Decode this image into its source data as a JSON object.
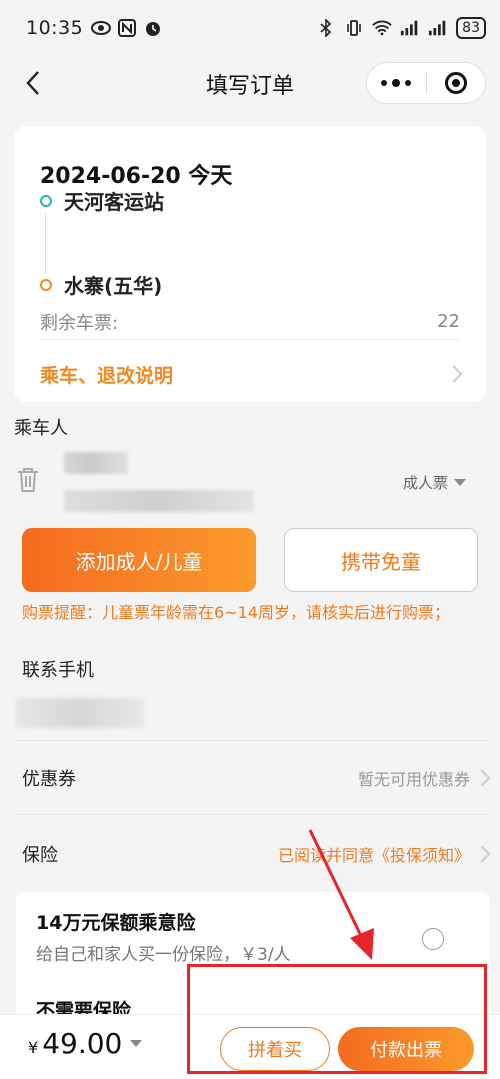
{
  "status_bar": {
    "time": "10:35",
    "battery": "83"
  },
  "nav": {
    "title": "填写订单"
  },
  "trip": {
    "date": "2024-06-20 今天",
    "from": "天河客运站",
    "to": "水寨(五华)",
    "remaining_label": "剩余车票:",
    "remaining_value": "22",
    "notice": "乘车、退改说明"
  },
  "passenger": {
    "section_label": "乘车人",
    "ticket_type": "成人票"
  },
  "actions": {
    "add_label": "添加成人/儿童",
    "child_label": "携带免童"
  },
  "reminder": "购票提醒：儿童票年龄需在6~14周岁，请核实后进行购票；",
  "contact": {
    "label": "联系手机"
  },
  "coupon": {
    "label": "优惠券",
    "value": "暂无可用优惠券"
  },
  "insurance": {
    "label": "保险",
    "agreement": "已阅读并同意《投保须知》",
    "option_title": "14万元保额乘意险",
    "option_sub": "给自己和家人买一份保险，￥3/人",
    "no_option": "不需要保险"
  },
  "bottom": {
    "currency": "¥",
    "price": "49.00",
    "share_label": "拼着买",
    "pay_label": "付款出票"
  },
  "colors": {
    "accent": "#f07a1e",
    "annotation": "#e8242b"
  }
}
